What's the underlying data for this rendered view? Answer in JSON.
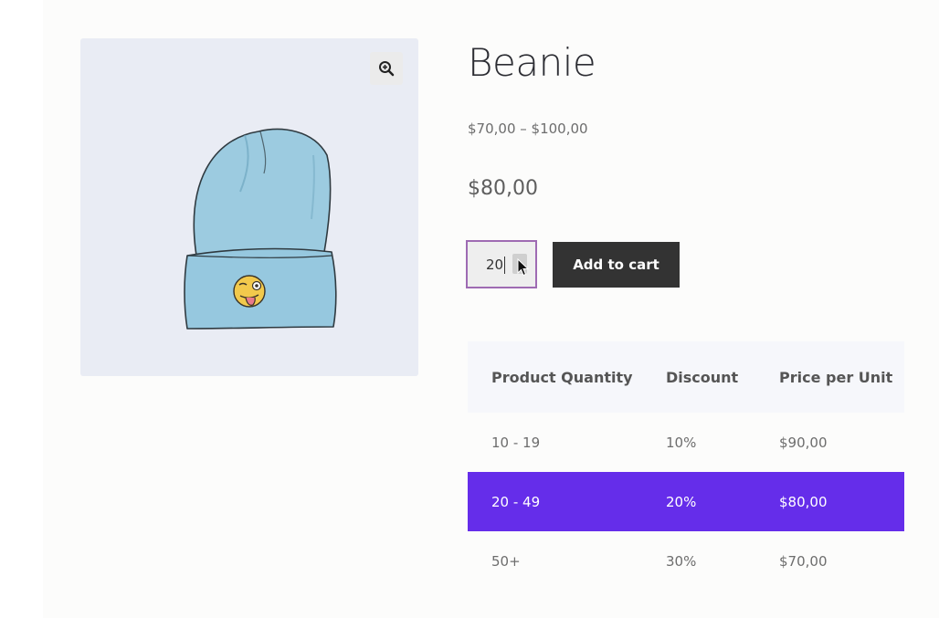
{
  "product": {
    "title": "Beanie",
    "price_range": "$70,00 – $100,00",
    "price_current": "$80,00",
    "image_icon": "beanie-hat-image",
    "zoom_icon": "zoom-in-icon"
  },
  "cart": {
    "quantity": "20",
    "add_to_cart_label": "Add to cart"
  },
  "pricing_table": {
    "headers": [
      "Product Quantity",
      "Discount",
      "Price per Unit"
    ],
    "rows": [
      {
        "quantity": "10 - 19",
        "discount": "10%",
        "price": "$90,00"
      },
      {
        "quantity": "20 - 49",
        "discount": "20%",
        "price": "$80,00",
        "active": true
      },
      {
        "quantity": "50+",
        "discount": "30%",
        "price": "$70,00"
      }
    ],
    "active_color": "#652dea"
  },
  "colors": {
    "button": "#333333",
    "qty_border": "#9e6bb3"
  }
}
